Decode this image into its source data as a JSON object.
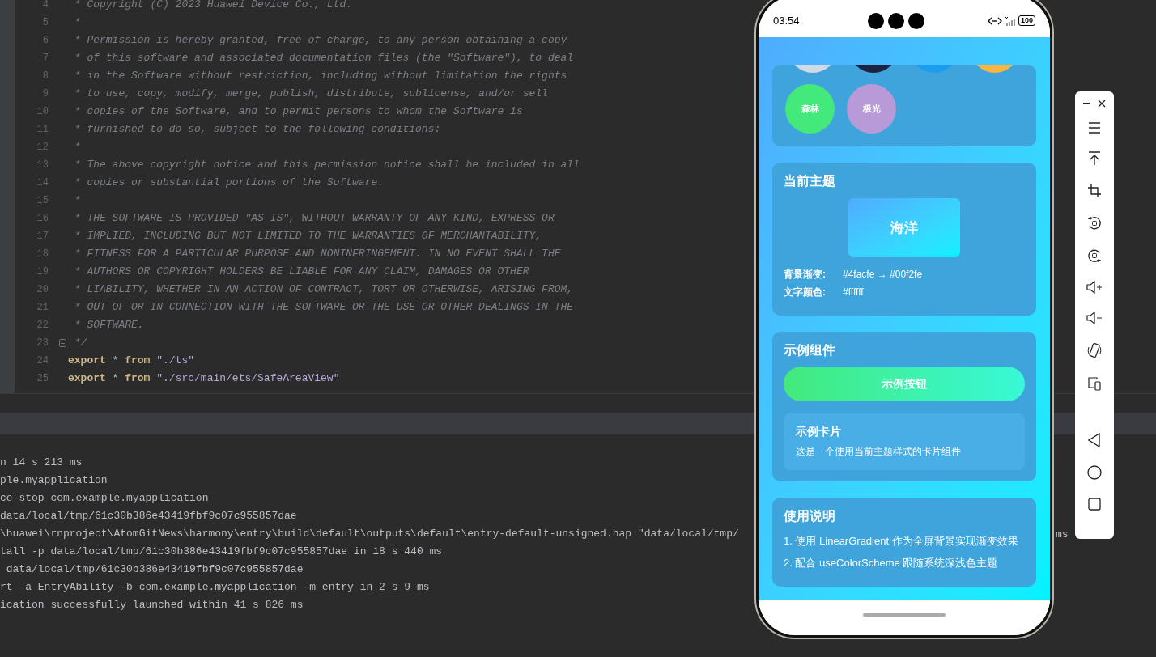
{
  "editor": {
    "lines": [
      {
        "number": "4",
        "kind": "comment",
        "text": " * Copyright (C) 2023 Huawei Device Co., Ltd."
      },
      {
        "number": "5",
        "kind": "comment",
        "text": " *"
      },
      {
        "number": "6",
        "kind": "comment",
        "text": " * Permission is hereby granted, free of charge, to any person obtaining a copy"
      },
      {
        "number": "7",
        "kind": "comment",
        "text": " * of this software and associated documentation files (the \"Software\"), to deal"
      },
      {
        "number": "8",
        "kind": "comment",
        "text": " * in the Software without restriction, including without limitation the rights"
      },
      {
        "number": "9",
        "kind": "comment",
        "text": " * to use, copy, modify, merge, publish, distribute, sublicense, and/or sell"
      },
      {
        "number": "10",
        "kind": "comment",
        "text": " * copies of the Software, and to permit persons to whom the Software is"
      },
      {
        "number": "11",
        "kind": "comment",
        "text": " * furnished to do so, subject to the following conditions:"
      },
      {
        "number": "12",
        "kind": "comment",
        "text": " *"
      },
      {
        "number": "13",
        "kind": "comment",
        "text": " * The above copyright notice and this permission notice shall be included in all"
      },
      {
        "number": "14",
        "kind": "comment",
        "text": " * copies or substantial portions of the Software."
      },
      {
        "number": "15",
        "kind": "comment",
        "text": " *"
      },
      {
        "number": "16",
        "kind": "comment",
        "text": " * THE SOFTWARE IS PROVIDED \"AS IS\", WITHOUT WARRANTY OF ANY KIND, EXPRESS OR"
      },
      {
        "number": "17",
        "kind": "comment",
        "text": " * IMPLIED, INCLUDING BUT NOT LIMITED TO THE WARRANTIES OF MERCHANTABILITY,"
      },
      {
        "number": "18",
        "kind": "comment",
        "text": " * FITNESS FOR A PARTICULAR PURPOSE AND NONINFRINGEMENT. IN NO EVENT SHALL THE"
      },
      {
        "number": "19",
        "kind": "comment",
        "text": " * AUTHORS OR COPYRIGHT HOLDERS BE LIABLE FOR ANY CLAIM, DAMAGES OR OTHER"
      },
      {
        "number": "20",
        "kind": "comment",
        "text": " * LIABILITY, WHETHER IN AN ACTION OF CONTRACT, TORT OR OTHERWISE, ARISING FROM,"
      },
      {
        "number": "21",
        "kind": "comment",
        "text": " * OUT OF OR IN CONNECTION WITH THE SOFTWARE OR THE USE OR OTHER DEALINGS IN THE"
      },
      {
        "number": "22",
        "kind": "comment",
        "text": " * SOFTWARE."
      },
      {
        "number": "23",
        "kind": "comment",
        "text": " */"
      },
      {
        "number": "24",
        "kind": "code",
        "tokens": [
          {
            "kind": "keyword",
            "text": "export"
          },
          {
            "kind": "plain",
            "text": " * "
          },
          {
            "kind": "keyword",
            "text": "from"
          },
          {
            "kind": "string",
            "text": " \"./ts\""
          }
        ]
      },
      {
        "number": "25",
        "kind": "code",
        "tokens": [
          {
            "kind": "keyword",
            "text": "export"
          },
          {
            "kind": "plain",
            "text": " * "
          },
          {
            "kind": "keyword",
            "text": "from"
          },
          {
            "kind": "string",
            "text": " \"./src/main/ets/SafeAreaView\""
          }
        ]
      }
    ]
  },
  "console": {
    "lines": [
      {
        "text": "n 14 s 213 ms"
      },
      {
        "text": "ple.myapplication"
      },
      {
        "text": "ce-stop com.example.myapplication"
      },
      {
        "text": "data/local/tmp/61c30b386e43419fbf9c07c955857dae"
      },
      {
        "text": "\\huawei\\rnproject\\AtomGitNews\\harmony\\entry\\build\\default\\outputs\\default\\entry-default-unsigned.hap \"data/local/tmp/",
        "tail": "ms"
      },
      {
        "text": "tall -p data/local/tmp/61c30b386e43419fbf9c07c955857dae in 18 s 440 ms"
      },
      {
        "text": " data/local/tmp/61c30b386e43419fbf9c07c955857dae"
      },
      {
        "text": "rt -a EntryAbility -b com.example.myapplication -m entry in 2 s 9 ms"
      },
      {
        "text": "ication successfully launched within 41 s 826 ms"
      }
    ]
  },
  "phone": {
    "status_bar": {
      "time": "03:54",
      "battery": "100"
    },
    "theme_card": {
      "themes": [
        {
          "color": "#d0d9e6"
        },
        {
          "color": "#1b2340"
        },
        {
          "color": "#1e9cf0"
        },
        {
          "color": "#f9b540"
        },
        {
          "label": "森林",
          "color": "#43e97b"
        },
        {
          "label": "极光",
          "color": "#b89ad8"
        }
      ]
    },
    "current_theme": {
      "title": "当前主题",
      "preview": "海洋",
      "rows": [
        {
          "label": "背景渐变:",
          "value": "#4facfe → #00f2fe"
        },
        {
          "label": "文字颜色:",
          "value": "#ffffff"
        }
      ]
    },
    "examples": {
      "title": "示例组件",
      "button": "示例按钮",
      "card": {
        "title": "示例卡片",
        "description": "这是一个使用当前主题样式的卡片组件"
      }
    },
    "usage": {
      "title": "使用说明",
      "lines": [
        "1. 使用 LinearGradient 作为全屏背景实现渐变效果",
        "2. 配合 useColorScheme 跟随系统深浅色主题"
      ]
    }
  }
}
